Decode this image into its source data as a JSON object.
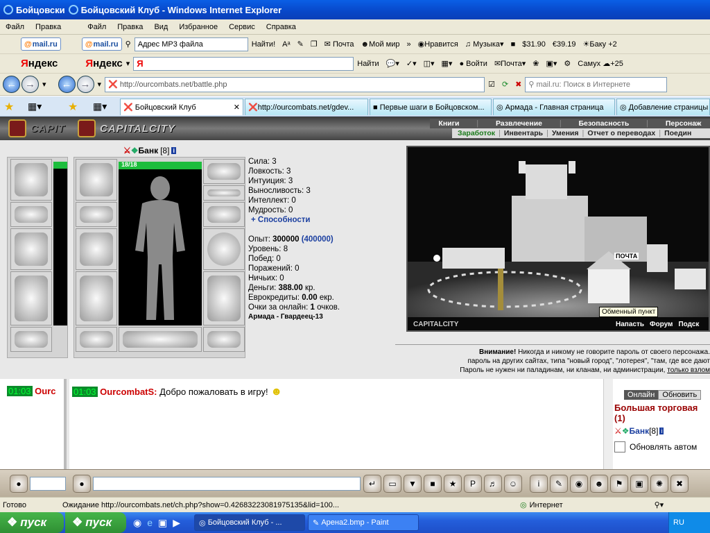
{
  "window": {
    "title_short": "Бойцовски",
    "title": "Бойцовский Клуб - Windows Internet Explorer"
  },
  "menu": {
    "left": [
      "Файл",
      "Правка"
    ],
    "right": [
      "Файл",
      "Правка",
      "Вид",
      "Избранное",
      "Сервис",
      "Справка"
    ]
  },
  "mail_toolbar": {
    "mail_label": "mail.ru",
    "address_label": "Адрес MP3 файла",
    "find_label": "Найти!",
    "pochta": "Почта",
    "moy_mir": "Мой мир",
    "nravitsya": "Нравится",
    "muzyka": "Музыка",
    "usd": "31.90",
    "eur": "39.19",
    "weather": "Баку +2"
  },
  "yandex_toolbar": {
    "logo": "Яндекс",
    "search_value": "Я",
    "find_label": "Найти",
    "voiti": "Войти",
    "pochta": "Почта",
    "city": "Самух",
    "temp": "+25"
  },
  "nav": {
    "url": "http://ourcombats.net/battle.php",
    "search_placeholder": "mail.ru: Поиск в Интернете"
  },
  "tabs": [
    {
      "label": "Бойцовский Клуб"
    },
    {
      "label": "http://ourcombats.net/gdev..."
    },
    {
      "label": "Первые шаги в Бойцовском..."
    },
    {
      "label": "Армада - Главная страница"
    },
    {
      "label": "Добавление страницы"
    }
  ],
  "game": {
    "logo": "CAPITALCITY",
    "top_menu": [
      "Книги",
      "Развлечение",
      "Безопасность",
      "Персонаж"
    ],
    "sub_menu": [
      "Заработок",
      "Инвентарь",
      "Умения",
      "Отчет о переводах",
      "Поедин"
    ],
    "char_name": "Банк",
    "char_level": "[8]",
    "hp": "18/18",
    "hp_fraction": 1.0,
    "stats": [
      "Сила: 3",
      "Ловкость: 3",
      "Интуиция: 3",
      "Выносливость: 3",
      "Интеллект: 0",
      "Мудрость: 0"
    ],
    "abilities": "+ Способности",
    "exp_label": "Опыт:",
    "exp_value": "300000",
    "exp_next": "(400000)",
    "info": [
      "Уровень: 8",
      "Побед: 0",
      "Поражений: 0",
      "Ничьих: 0"
    ],
    "money_label": "Деньги:",
    "money_value": "388.00",
    "money_unit": "кр.",
    "euro_label": "Еврокредиты:",
    "euro_value": "0.00",
    "euro_unit": "екр.",
    "online_label": "Очки за онлайн:",
    "online_value": "1",
    "online_unit": "очков.",
    "clan": "Армада - Гвардеец-13",
    "scene_logo": "CAPITALCITY",
    "tooltip": "Обменный пункт",
    "sign": "ПОЧТА",
    "scene_links": [
      "Напасть",
      "Форум",
      "Подск"
    ],
    "warning_bold": "Внимание!",
    "warning_1": " Никогда и никому не говорите пароль от своего персонажа.",
    "warning_2": "пароль на других сайтах, типа \"новый город\", \"лотерея\", \"там, где все дают",
    "warning_3": "Пароль не нужен ни паладинам, ни кланам, ни администрации,",
    "warning_link": "только взлом"
  },
  "chat": {
    "time": "01:03",
    "sender": "OurcombatS:",
    "sender_short": "Ourc",
    "message": "Добро пожаловать в игру!"
  },
  "sidebar": {
    "online_btn": "Онлайн",
    "refresh_btn": "Обновить",
    "room_title": "Большая торговая",
    "room_count": "(1)",
    "user_name": "Банк",
    "user_level": "[8]",
    "auto_label": "Обновлять автом"
  },
  "status": {
    "left": "Готово",
    "loading": "Ожидание http://ourcombats.net/ch.php?show=0.42683223081975135&lid=100...",
    "zone": "Интернет"
  },
  "taskbar": {
    "start": "пуск",
    "tasks": [
      "Бойцовский Клуб - ...",
      "Арена2.bmp - Paint"
    ],
    "lang": "RU"
  },
  "colors": {
    "accent": "#0a5fe6",
    "hp": "#1dbd3d",
    "exp_next": "#1b3fa0",
    "sender": "#c00000"
  }
}
